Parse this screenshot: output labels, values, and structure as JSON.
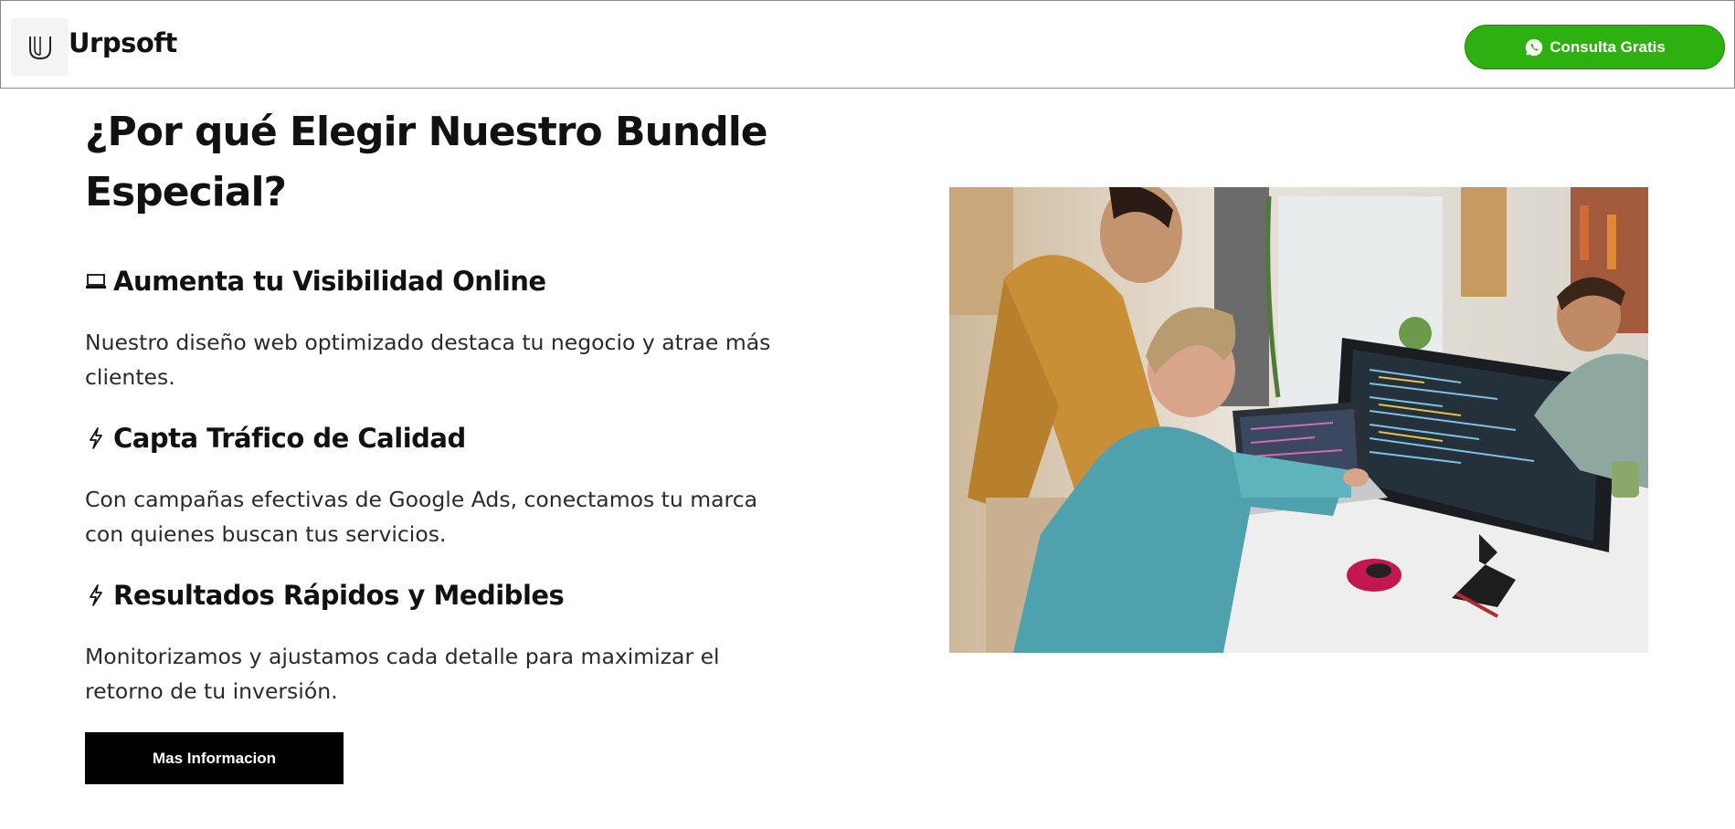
{
  "header": {
    "brand": "Urpsoft",
    "logo_icon": "urpsoft-logo-icon",
    "cta_label": "Consulta Gratis",
    "cta_icon": "whatsapp-icon",
    "cta_color": "#2eb00f"
  },
  "section": {
    "title": "¿Por qué Elegir Nuestro Bundle Especial?",
    "features": [
      {
        "icon": "laptop-icon",
        "title": "Aumenta tu Visibilidad Online",
        "text": "Nuestro diseño web optimizado destaca tu negocio y atrae más clientes."
      },
      {
        "icon": "lightning-icon",
        "title": "Capta Tráfico de Calidad",
        "text": "Con campañas efectivas de Google Ads, conectamos tu marca con quienes buscan tus servicios."
      },
      {
        "icon": "lightning-icon",
        "title": "Resultados Rápidos y Medibles",
        "text": "Monitorizamos y ajustamos cada detalle para maximizar el retorno de tu inversión."
      }
    ],
    "button_label": "Mas Informacion"
  },
  "image": {
    "subject": "team-working-at-computers-photo"
  }
}
